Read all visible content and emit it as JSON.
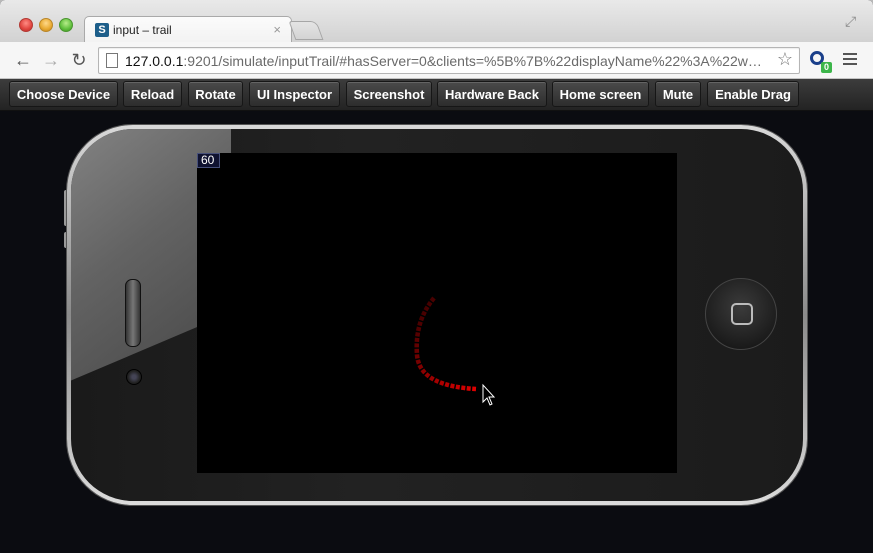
{
  "browser": {
    "tab_title": "input – trail",
    "tab_close": "×",
    "url_host": "127.0.0.1",
    "url_rest": ":9201/simulate/inputTrail/#hasServer=0&clients=%5B%7B%22displayName%22%3A%22wo…",
    "extension_badge": "0",
    "icons": {
      "back": "arrow-left-icon",
      "forward": "arrow-right-icon",
      "reload": "reload-icon",
      "bookmark": "star-icon",
      "menu": "hamburger-menu-icon",
      "fullscreen": "expand-icon"
    }
  },
  "toolbar": {
    "buttons": [
      "Choose Device",
      "Reload",
      "Rotate",
      "UI Inspector",
      "Screenshot",
      "Hardware Back",
      "Home screen",
      "Mute",
      "Enable Drag"
    ]
  },
  "simulator": {
    "fps": "60",
    "trail_color": "#e00000"
  }
}
